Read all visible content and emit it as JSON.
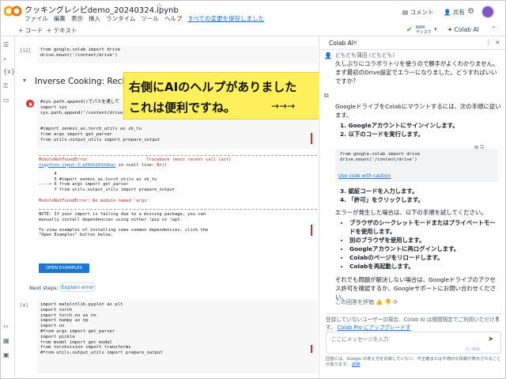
{
  "header": {
    "title": "クッキングレシピdemo_20240324.ipynb",
    "menus": [
      "ファイル",
      "編集",
      "表示",
      "挿入",
      "ランタイム",
      "ツール",
      "ヘルプ"
    ],
    "saved_status": "すべての変更を保存しました",
    "comment": "コメント",
    "share": "共有"
  },
  "toolbar": {
    "add_code": "+ コード",
    "add_text": "+ テキスト",
    "ram_label": "RAM",
    "disk_label": "ディスク",
    "gemini": "Colab AI"
  },
  "cells": {
    "c1_prompt": "[12]",
    "c1_code": "from google.colab import drive\ndrive.mount('/content/drive')",
    "section_title": "Inverse Cooking: Recipe Generation from Food Images",
    "c2_code": "#sys.path.append()でパスを通して\nimport sys\nsys.path.append('/content/drive/MyDrive/...')\n\n\n#import zenkoi_ai.torch_utils as zk_tu\nfrom args import get_parser\nfrom utils.output_utils import prepare_output",
    "c2_err_head": "ModuleNotFoundError                       Traceback (most recent call last)",
    "c2_err_link": "<ipython-input-3-a30d2d932dba>",
    "c2_err_loc": " in <cell line: 6>()",
    "c2_tb": "      4\n      5 #import zenkoi_ai.torch_utils as zk_tu\n----> 6 from args import get_parser\n      7 from utils.output_utils import prepare_output",
    "c2_err_msg": "ModuleNotFoundError: No module named 'args'",
    "c2_note": "NOTE: If your import is failing due to a missing package, you can\nmanually install dependencies using either !pip or !apt.\n\nTo view examples of installing some common dependencies, click the\n\"Open Examples\" button below.",
    "open_examples": "OPEN EXAMPLES",
    "next_steps": "Next steps:",
    "explain_error": "Explain error",
    "c3_prompt": "[4]",
    "c3_code": "import matplotlib.pyplot as plt\nimport torch\nimport torch.nn as nn\nimport numpy as np\nimport os\n#from args import get_parser\nimport pickle\nfrom model import get_model\nfrom torchvision import transforms\n#from utils.output_utils import prepare_output"
  },
  "annotation": {
    "line1": "右側にAIのヘルプがありました",
    "line2": "これは便利ですね。",
    "arrow": "→→→"
  },
  "panel": {
    "title": "Colab AI",
    "user_name": "どもども蒲田 (どもども)",
    "user_msg": "久しぶりにコラボラトリを使うので勝手がよくわかりません。まず最初のDrive設定でエラーになりました。どうすればいいですか？",
    "ai_intro": "GoogleドライブをColabにマウントするには、次の手順に従います。",
    "steps_a": [
      "1. Googleアカウントにサインインします。",
      "2. 以下のコードを実行します。"
    ],
    "code": "from google.colab import drive\ndrive.mount('/content/drive')",
    "use_code": "Use code with caution",
    "steps_b": [
      "3. 認証コードを入力します。",
      "4. 「許可」をクリックします。"
    ],
    "err_intro": "エラーが発生した場合は、以下の手順を試してください。",
    "tips": [
      "ブラウザのシークレットモードまたはプライベートモードを使用します。",
      "別のブラウザを使用します。",
      "Googleアカウントに再ログインします。",
      "Colabのページをリロードします。",
      "Colabを再起動します。"
    ],
    "fallback": "それでも問題が解決しない場合は、Googleドライブのアクセス許可を確認するか、Googleサポートにお問い合わせください。",
    "rate": "この回答を評価",
    "notice": "登録していないユーザーの場合、Colab AI は期間限定でご利用いただけます。",
    "notice_link": "Colab Pro にアップグレードす",
    "input_placeholder": "ここにメッセージを入力",
    "counter": "0 / 400",
    "disclaimer": "回答には、Google の考え方を反映していない、不正確または不適切な情報が表示されることがあります。",
    "disclaimer_link": "詳細"
  }
}
